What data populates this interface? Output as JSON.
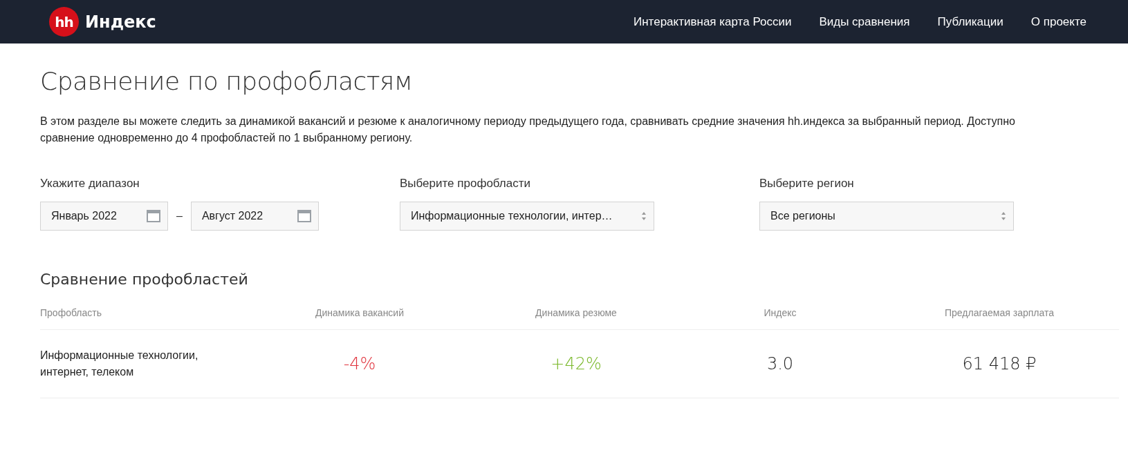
{
  "header": {
    "logo_mark": "hh",
    "logo_text": "Индекс",
    "nav": [
      {
        "label": "Интерактивная карта России"
      },
      {
        "label": "Виды сравнения"
      },
      {
        "label": "Публикации"
      },
      {
        "label": "О проекте"
      }
    ]
  },
  "page": {
    "title": "Сравнение по профобластям",
    "description": "В этом разделе вы можете следить за динамикой вакансий и резюме к аналогичному периоду предыдущего года, сравнивать средние значения hh.индекса за выбранный период. Доступно сравнение одновременно до 4 профобластей по 1 выбранному региону."
  },
  "filters": {
    "range": {
      "label": "Укажите диапазон",
      "from": "Январь 2022",
      "separator": "–",
      "to": "Август 2022"
    },
    "profarea": {
      "label": "Выберите профобласти",
      "value": "Информационные технологии, интер…"
    },
    "region": {
      "label": "Выберите регион",
      "value": "Все регионы"
    }
  },
  "comparison": {
    "title": "Сравнение профобластей",
    "columns": [
      "Профобласть",
      "Динамика вакансий",
      "Динамика резюме",
      "Индекс",
      "Предлагаемая зарплата"
    ],
    "rows": [
      {
        "profarea": "Информационные технологии, интернет, телеком",
        "vacancies": {
          "value": "-4%",
          "negative": true
        },
        "resumes": {
          "value": "+42%",
          "negative": false
        },
        "index": "3.0",
        "salary": "61 418 ₽"
      }
    ]
  }
}
